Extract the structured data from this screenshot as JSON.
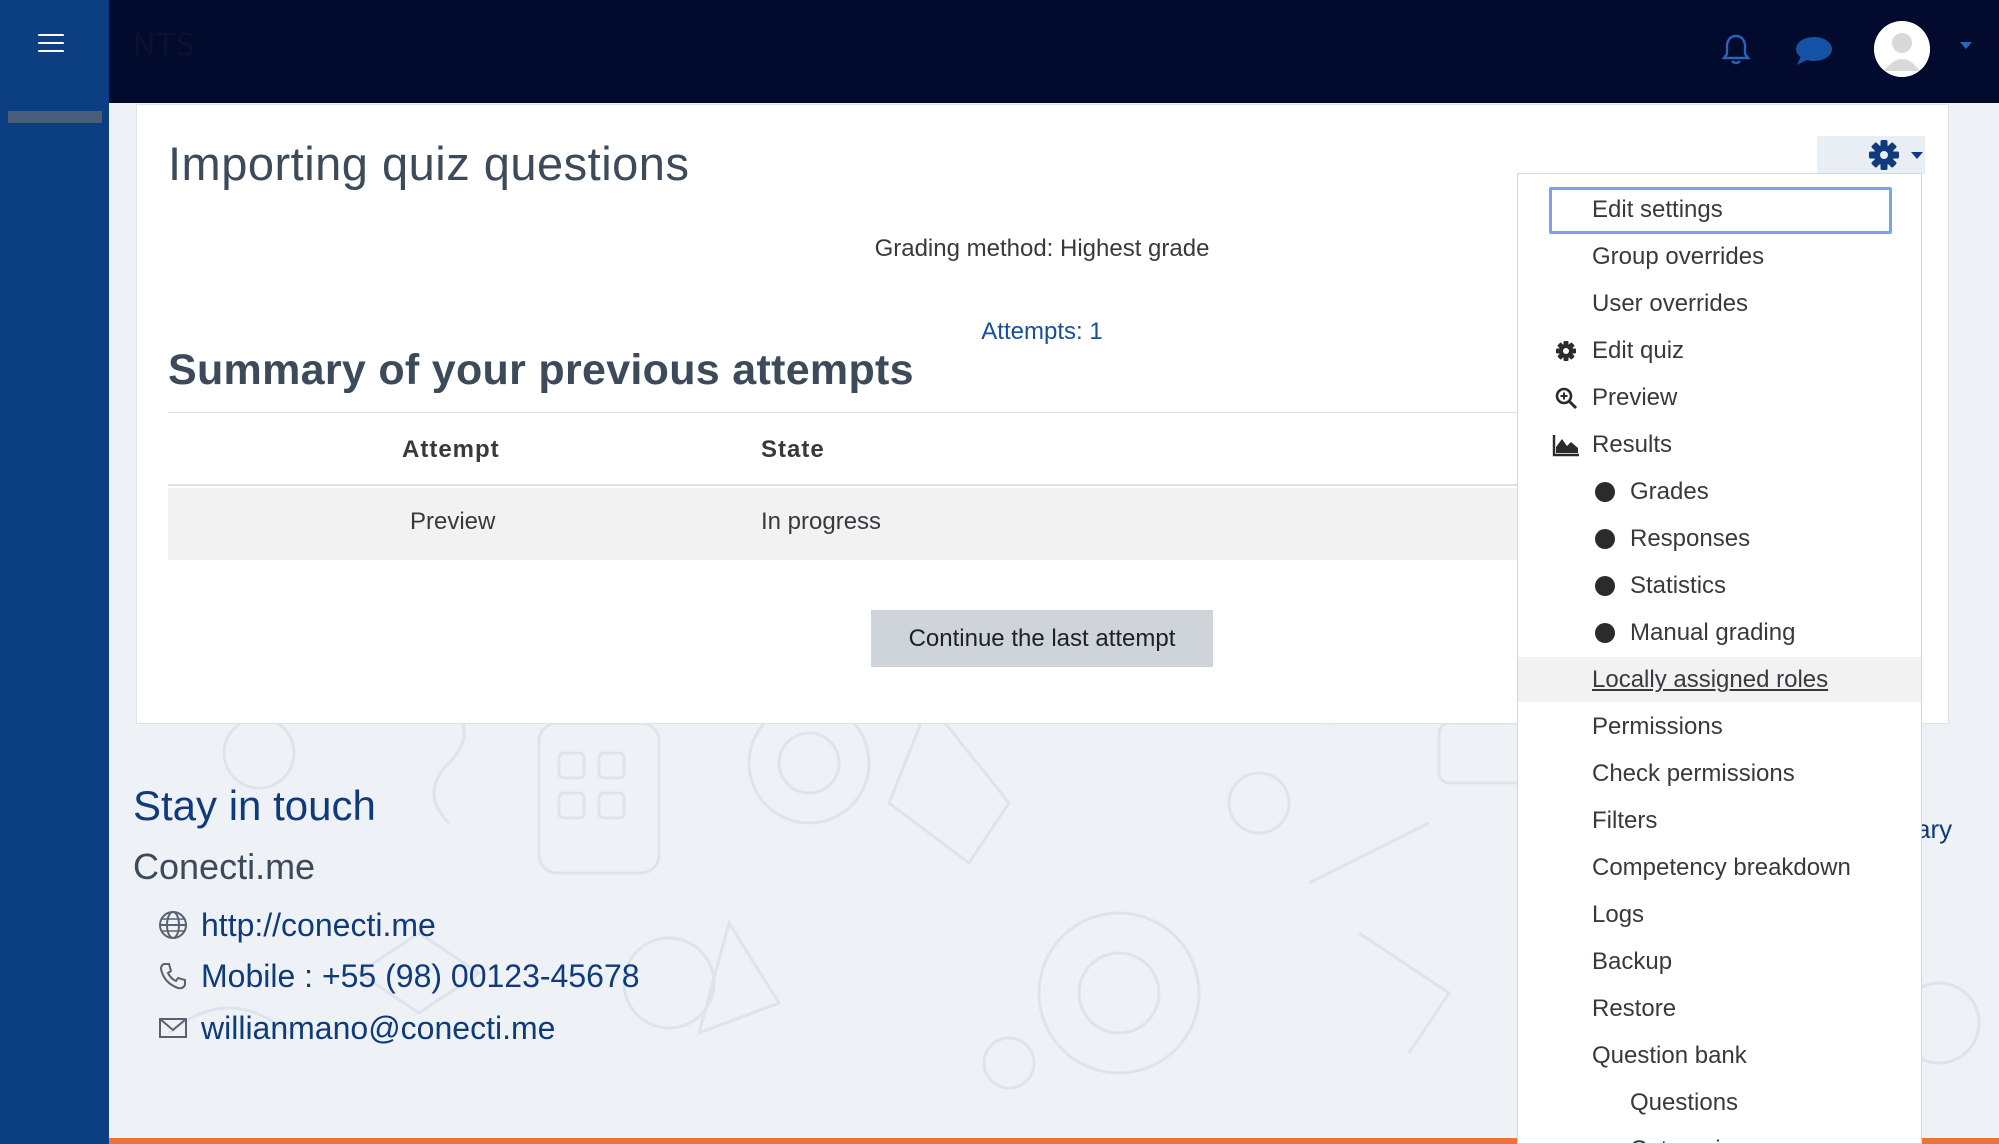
{
  "navbar": {
    "brand": "NTS"
  },
  "page": {
    "title": "Importing quiz questions",
    "grading_method": "Grading method: Highest grade",
    "attempts_link": "Attempts: 1",
    "summary_title": "Summary of your previous attempts",
    "table": {
      "headers": [
        "Attempt",
        "State"
      ],
      "rows": [
        [
          "Preview",
          "In progress"
        ]
      ]
    },
    "continue_button": "Continue the last attempt"
  },
  "footer": {
    "stay_in_touch": "Stay in touch",
    "site_name": "Conecti.me",
    "website": "http://conecti.me",
    "mobile": "Mobile : +55 (98) 00123-45678",
    "email": "willianmano@conecti.me",
    "partial_link": "ary"
  },
  "menu": {
    "items": [
      {
        "label": "Edit settings",
        "icon": "",
        "level": 0
      },
      {
        "label": "Group overrides",
        "icon": "",
        "level": 0
      },
      {
        "label": "User overrides",
        "icon": "",
        "level": 0
      },
      {
        "label": "Edit quiz",
        "icon": "gear-icon",
        "level": 0
      },
      {
        "label": "Preview",
        "icon": "zoom-icon",
        "level": 0
      },
      {
        "label": "Results",
        "icon": "area-chart-icon",
        "level": 0
      },
      {
        "label": "Grades",
        "icon": "dot",
        "level": 1
      },
      {
        "label": "Responses",
        "icon": "dot",
        "level": 1
      },
      {
        "label": "Statistics",
        "icon": "dot",
        "level": 1
      },
      {
        "label": "Manual grading",
        "icon": "dot",
        "level": 1
      },
      {
        "label": "Locally assigned roles",
        "icon": "",
        "level": 0
      },
      {
        "label": "Permissions",
        "icon": "",
        "level": 0
      },
      {
        "label": "Check permissions",
        "icon": "",
        "level": 0
      },
      {
        "label": "Filters",
        "icon": "",
        "level": 0
      },
      {
        "label": "Competency breakdown",
        "icon": "",
        "level": 0
      },
      {
        "label": "Logs",
        "icon": "",
        "level": 0
      },
      {
        "label": "Backup",
        "icon": "",
        "level": 0
      },
      {
        "label": "Restore",
        "icon": "",
        "level": 0
      },
      {
        "label": "Question bank",
        "icon": "",
        "level": 0
      },
      {
        "label": "Questions",
        "icon": "",
        "level": 1
      },
      {
        "label": "Categories",
        "icon": "",
        "level": 1
      }
    ]
  },
  "colors": {
    "navbar": "#020b2e",
    "drawer": "#0b3f82",
    "link": "#1a4d9c",
    "footer_accent": "#e8743b"
  }
}
